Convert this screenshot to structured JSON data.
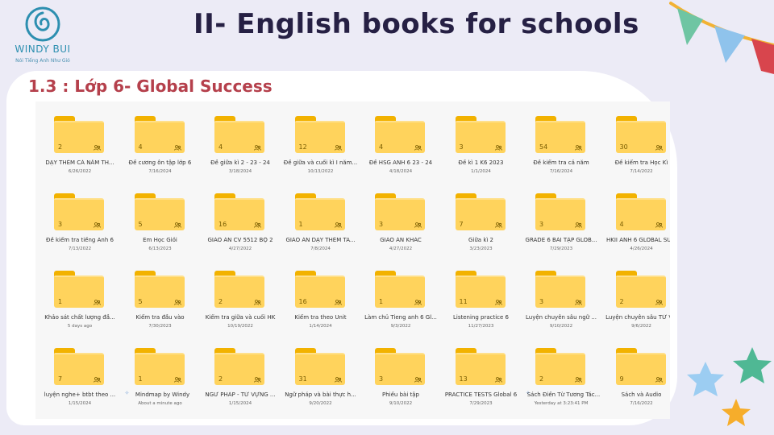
{
  "logo": {
    "name": "WINDY BUI",
    "tagline": "Nói Tiếng Anh Như Gió"
  },
  "title": "II- English books for schools",
  "subtitle": "1.3 : Lớp 6- Global Success",
  "colors": {
    "folder_body": "#ffd35c",
    "folder_tab": "#f2b200",
    "title": "#262044",
    "subtitle": "#b5404c",
    "logo": "#2d8fb0"
  },
  "folders": [
    {
      "count": "2",
      "name": "DẠY THÊM CẢ NĂM TH...",
      "date": "6/26/2022",
      "icon": "folder-icon"
    },
    {
      "count": "4",
      "name": "Đề cương ôn tập lớp 6",
      "date": "7/16/2024",
      "icon": "folder-icon"
    },
    {
      "count": "4",
      "name": "Đề giữa kì 2 - 23 - 24",
      "date": "3/18/2024",
      "icon": "folder-icon"
    },
    {
      "count": "12",
      "name": "Đề giữa và cuối kì I năm...",
      "date": "10/13/2022",
      "icon": "folder-icon"
    },
    {
      "count": "4",
      "name": "Đề HSG ANH 6 23 - 24",
      "date": "4/18/2024",
      "icon": "folder-icon"
    },
    {
      "count": "3",
      "name": "Đề kì 1 K6 2023",
      "date": "1/1/2024",
      "icon": "folder-icon"
    },
    {
      "count": "54",
      "name": "Đề kiểm tra cả năm",
      "date": "7/16/2024",
      "icon": "folder-icon"
    },
    {
      "count": "30",
      "name": "Đề kiểm tra Học Kì",
      "date": "7/14/2022",
      "icon": "folder-icon"
    },
    {
      "count": "3",
      "name": "Đề kiểm tra tiếng Anh 6",
      "date": "7/13/2022",
      "icon": "folder-icon"
    },
    {
      "count": "5",
      "name": "Em Học Giỏi",
      "date": "6/13/2023",
      "icon": "folder-icon"
    },
    {
      "count": "16",
      "name": "GIÁO ÁN CV 5512 BỘ 2",
      "date": "4/27/2022",
      "icon": "folder-icon"
    },
    {
      "count": "1",
      "name": "GIÁO ÁN DẠY THÊM TA...",
      "date": "7/8/2024",
      "icon": "folder-icon"
    },
    {
      "count": "3",
      "name": "GIÁO ÁN KHÁC",
      "date": "4/27/2022",
      "icon": "folder-icon"
    },
    {
      "count": "7",
      "name": "Giữa kì 2",
      "date": "3/23/2023",
      "icon": "folder-icon"
    },
    {
      "count": "3",
      "name": "GRADE 6 BÀI TẬP GLOB...",
      "date": "7/29/2023",
      "icon": "folder-icon"
    },
    {
      "count": "4",
      "name": "HKII ANH 6 GLOBAL SU...",
      "date": "4/26/2024",
      "icon": "folder-icon"
    },
    {
      "count": "1",
      "name": "Khảo sát chất lượng đầ...",
      "date": "5 days ago",
      "icon": "folder-icon"
    },
    {
      "count": "5",
      "name": "Kiểm tra đầu vào",
      "date": "7/30/2023",
      "icon": "folder-icon"
    },
    {
      "count": "2",
      "name": "Kiểm tra giữa và cuối HK",
      "date": "10/19/2022",
      "icon": "folder-icon"
    },
    {
      "count": "16",
      "name": "Kiểm tra theo Unit",
      "date": "1/14/2024",
      "icon": "folder-icon"
    },
    {
      "count": "1",
      "name": "Làm chủ Tieng anh 6 Gl...",
      "date": "9/3/2022",
      "icon": "folder-icon"
    },
    {
      "count": "11",
      "name": "Listening practice 6",
      "date": "11/27/2023",
      "icon": "folder-icon"
    },
    {
      "count": "3",
      "name": "Luyện chuyên sâu ngữ ...",
      "date": "9/10/2022",
      "icon": "folder-icon"
    },
    {
      "count": "2",
      "name": "Luyện chuyên sâu TỪ V...",
      "date": "9/6/2022",
      "icon": "folder-icon"
    },
    {
      "count": "7",
      "name": "luyện nghe+ btbt theo ...",
      "date": "1/15/2024",
      "icon": "folder-icon"
    },
    {
      "count": "1",
      "name": "Mindmap by Windy",
      "date": "About a minute ago",
      "icon": "folder-icon",
      "new": true
    },
    {
      "count": "2",
      "name": "NGỮ PHÁP - TỪ VỰNG ...",
      "date": "1/15/2024",
      "icon": "folder-icon"
    },
    {
      "count": "31",
      "name": "Ngữ pháp và bài thực h...",
      "date": "9/20/2022",
      "icon": "folder-icon"
    },
    {
      "count": "3",
      "name": "Phiếu bài tập",
      "date": "9/10/2022",
      "icon": "folder-icon"
    },
    {
      "count": "13",
      "name": "PRACTICE TESTS Global 6",
      "date": "7/29/2023",
      "icon": "folder-icon"
    },
    {
      "count": "2",
      "name": "Sách Điền Từ Tương Tác...",
      "date": "Yesterday at 3:23:41 PM",
      "icon": "folder-icon",
      "new": true
    },
    {
      "count": "9",
      "name": "Sách và Audio",
      "date": "7/16/2022",
      "icon": "folder-icon"
    }
  ]
}
